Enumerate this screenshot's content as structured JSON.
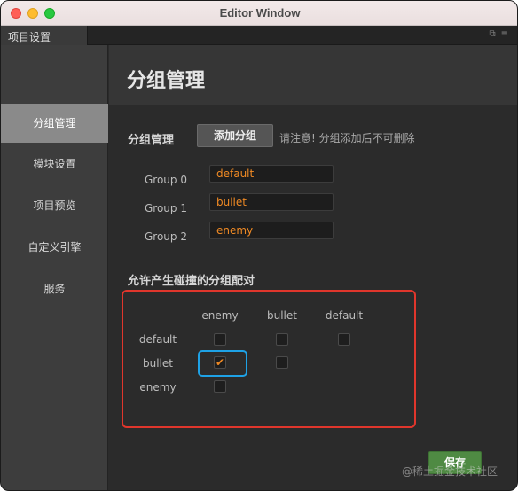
{
  "window": {
    "title": "Editor Window"
  },
  "tab": {
    "label": "项目设置"
  },
  "sidebar": {
    "items": [
      {
        "label": "分组管理",
        "active": true
      },
      {
        "label": "模块设置",
        "active": false
      },
      {
        "label": "项目预览",
        "active": false
      },
      {
        "label": "自定义引擎",
        "active": false
      },
      {
        "label": "服务",
        "active": false
      }
    ]
  },
  "main": {
    "page_title": "分组管理",
    "section_label": "分组管理",
    "add_button": "添加分组",
    "notice": "请注意! 分组添加后不可删除",
    "groups": [
      {
        "label": "Group 0",
        "value": "default"
      },
      {
        "label": "Group 1",
        "value": "bullet"
      },
      {
        "label": "Group 2",
        "value": "enemy"
      }
    ],
    "collision_title": "允许产生碰撞的分组配对",
    "columns": [
      "enemy",
      "bullet",
      "default"
    ],
    "rows": [
      {
        "label": "default",
        "checks": [
          false,
          false,
          false
        ]
      },
      {
        "label": "bullet",
        "checks": [
          true,
          false
        ]
      },
      {
        "label": "enemy",
        "checks": [
          false
        ]
      }
    ],
    "save_button": "保存",
    "watermark": "@稀土掘金技术社区"
  },
  "colors": {
    "accent": "#f08a24",
    "highlight_red": "#e0362c",
    "highlight_blue": "#1ea2e6",
    "save": "#4f8a43"
  },
  "icons": {
    "checkmark": "✔"
  }
}
